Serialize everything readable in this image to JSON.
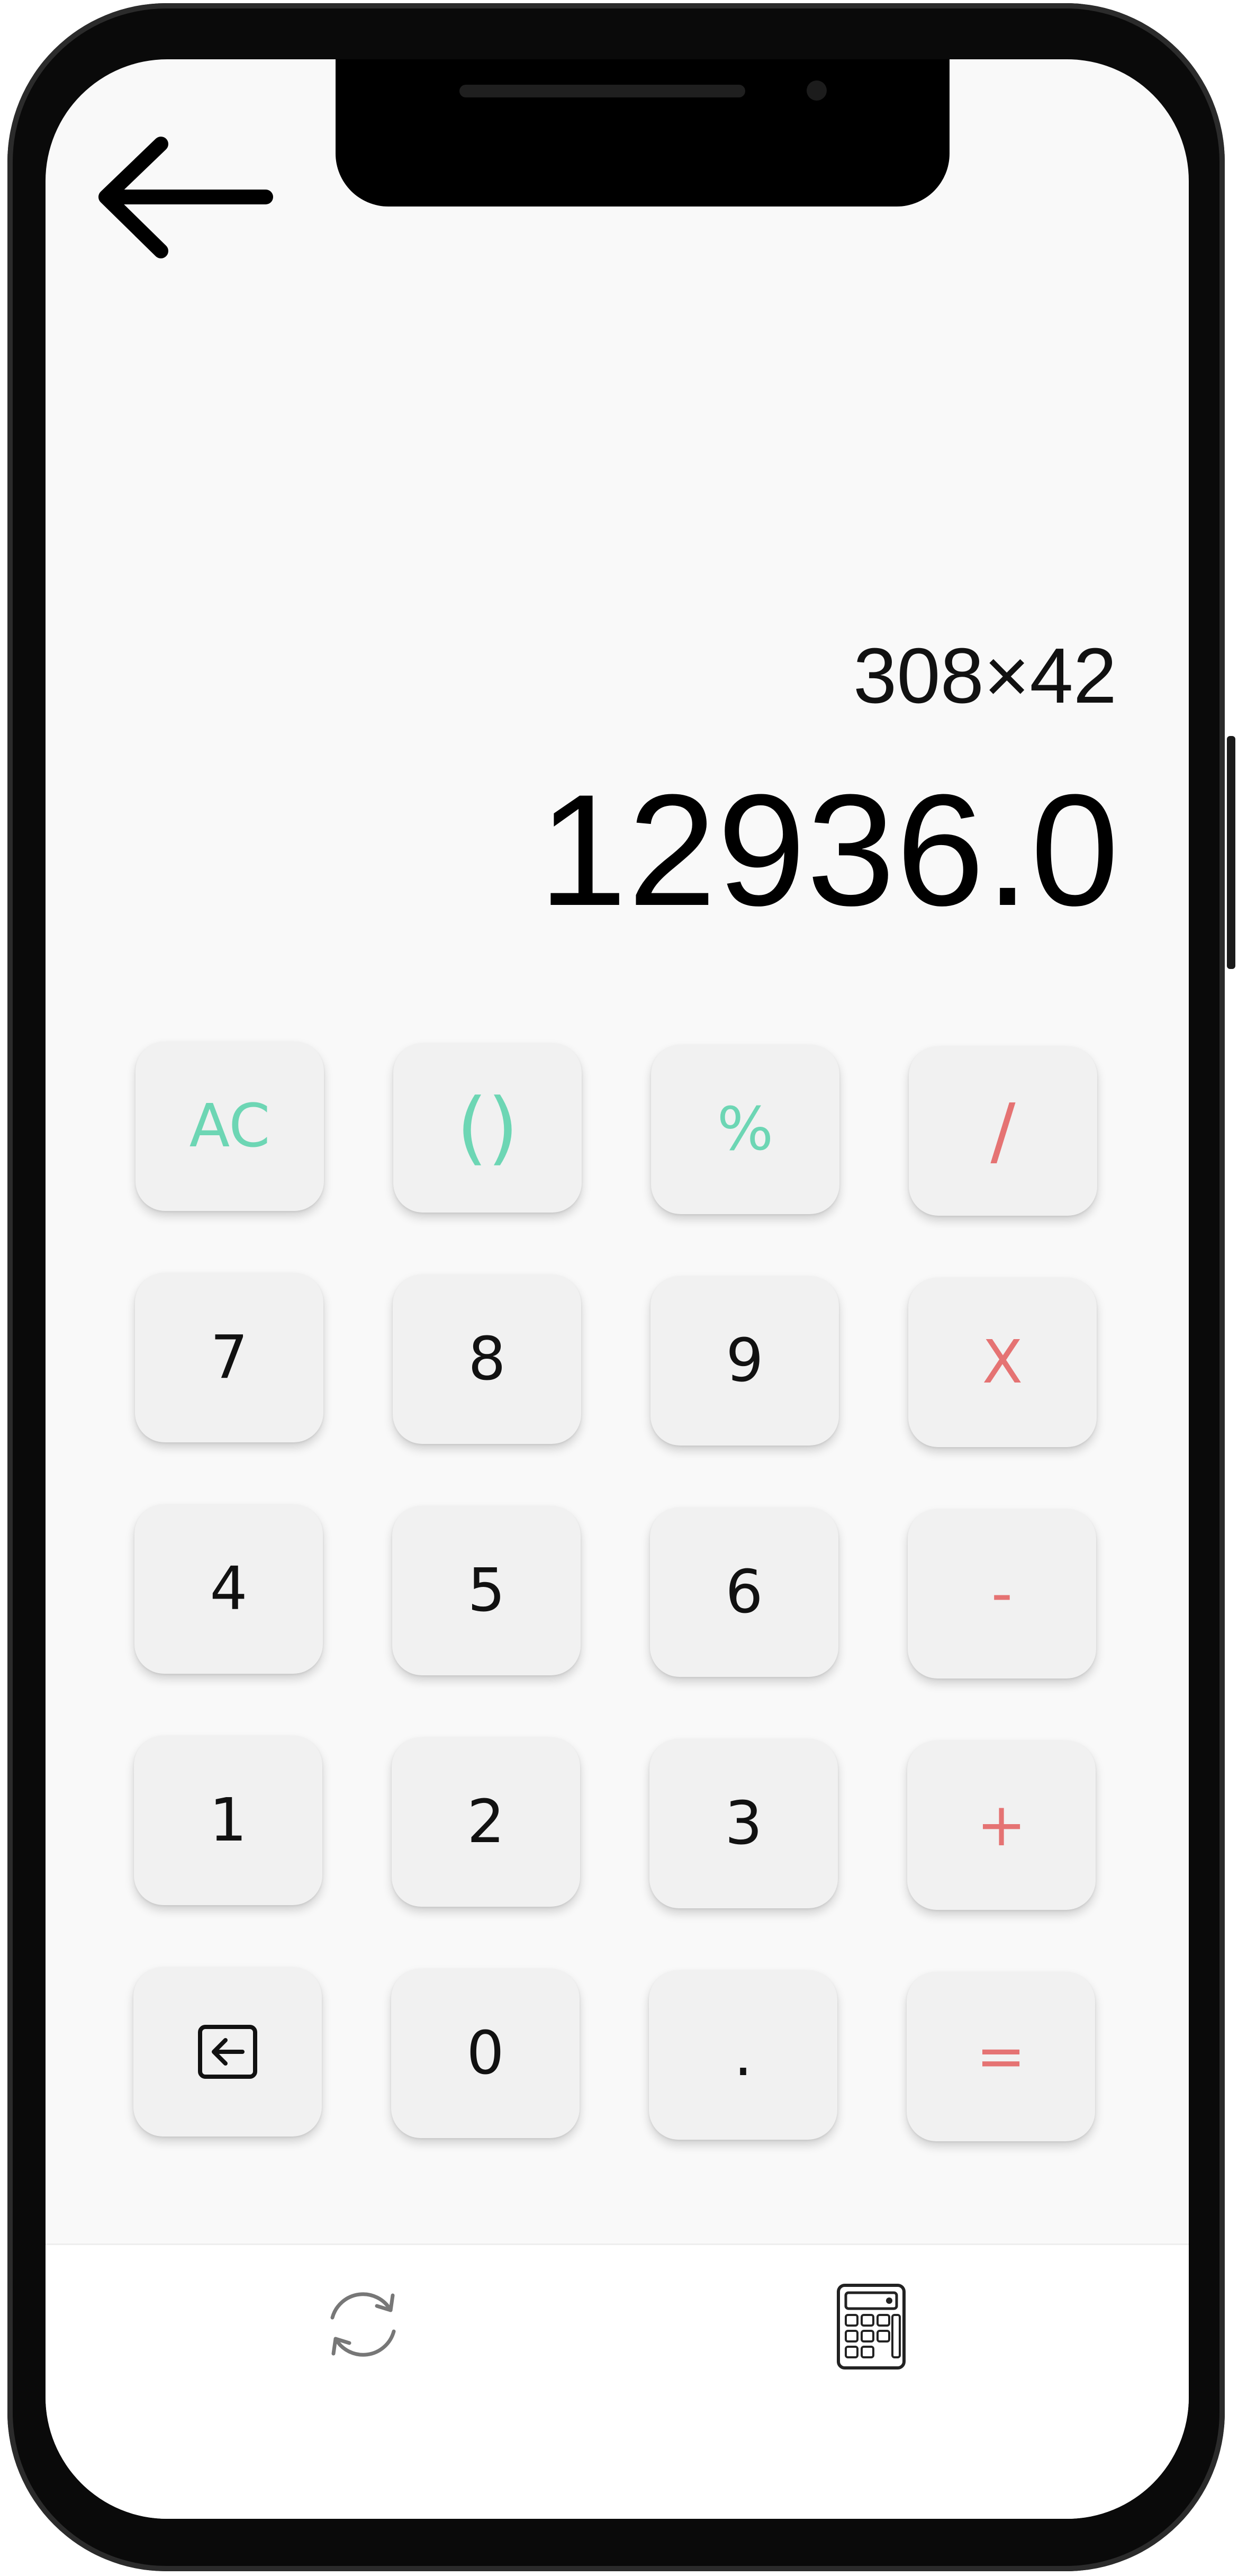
{
  "display": {
    "expression": "308×42",
    "result": "12936.0"
  },
  "colors": {
    "accent_green": "#6dd6b4",
    "accent_red": "#e57373",
    "key_background": "#f1f1f1",
    "screen_background": "#f9f9f9"
  },
  "keys": {
    "ac": "AC",
    "paren": "()",
    "percent": "%",
    "divide": "/",
    "seven": "7",
    "eight": "8",
    "nine": "9",
    "multiply": "X",
    "four": "4",
    "five": "5",
    "six": "6",
    "minus": "-",
    "one": "1",
    "two": "2",
    "three": "3",
    "plus": "+",
    "backspace_icon": "backspace-icon",
    "zero": "0",
    "dot": ".",
    "equals": "="
  },
  "icons": {
    "back": "arrow-left-icon",
    "converter": "refresh-icon",
    "calculator": "calculator-icon"
  }
}
